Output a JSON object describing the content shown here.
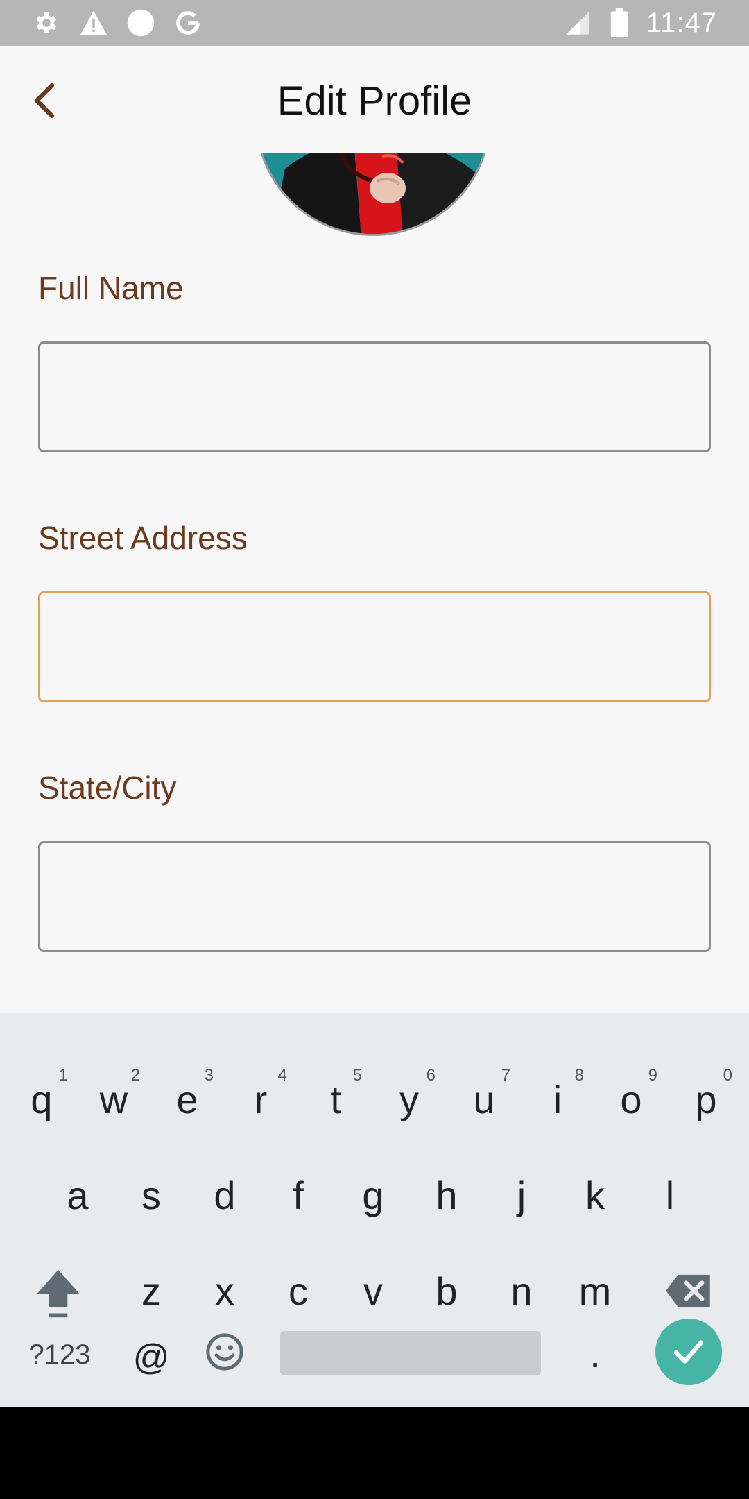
{
  "status_bar": {
    "time": "11:47",
    "left_icons": [
      "gear-icon",
      "warning-icon",
      "circle-icon",
      "google-icon"
    ],
    "right_icons": [
      "signal-icon",
      "battery-icon"
    ]
  },
  "app_bar": {
    "title": "Edit Profile",
    "back_icon": "chevron-left-icon"
  },
  "form": {
    "full_name_label": "Full Name",
    "full_name_value": "",
    "street_address_label": "Street Address",
    "street_address_value": "",
    "state_city_label": "State/City",
    "state_city_value": ""
  },
  "keyboard": {
    "row1": [
      {
        "k": "q",
        "h": "1"
      },
      {
        "k": "w",
        "h": "2"
      },
      {
        "k": "e",
        "h": "3"
      },
      {
        "k": "r",
        "h": "4"
      },
      {
        "k": "t",
        "h": "5"
      },
      {
        "k": "y",
        "h": "6"
      },
      {
        "k": "u",
        "h": "7"
      },
      {
        "k": "i",
        "h": "8"
      },
      {
        "k": "o",
        "h": "9"
      },
      {
        "k": "p",
        "h": "0"
      }
    ],
    "row2": [
      "a",
      "s",
      "d",
      "f",
      "g",
      "h",
      "j",
      "k",
      "l"
    ],
    "row3": [
      "z",
      "x",
      "c",
      "v",
      "b",
      "n",
      "m"
    ],
    "symbols_label": "?123",
    "at_label": "@",
    "period_label": ".",
    "shift_icon": "shift-icon",
    "backspace_icon": "backspace-icon",
    "emoji_icon": "emoji-icon",
    "enter_icon": "check-icon"
  },
  "colors": {
    "label": "#6b3a1f",
    "focus_border": "#e6a055",
    "enter_key": "#46b5a5"
  }
}
